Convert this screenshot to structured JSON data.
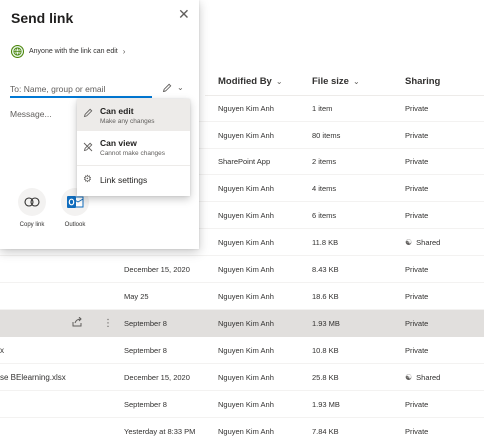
{
  "columns": {
    "modified_by": "Modified By",
    "file_size": "File size",
    "sharing": "Sharing"
  },
  "rows": [
    {
      "name": "",
      "modified": "",
      "modified_by": "Nguyen Kim Anh",
      "size": "1 item",
      "sharing": "Private"
    },
    {
      "name": "",
      "modified": "",
      "modified_by": "Nguyen Kim Anh",
      "size": "80 items",
      "sharing": "Private"
    },
    {
      "name": "",
      "modified": "",
      "modified_by": "SharePoint App",
      "size": "2 items",
      "sharing": "Private"
    },
    {
      "name": "",
      "modified": "",
      "modified_by": "Nguyen Kim Anh",
      "size": "4 items",
      "sharing": "Private"
    },
    {
      "name": "",
      "modified": "",
      "modified_by": "Nguyen Kim Anh",
      "size": "6 items",
      "sharing": "Private"
    },
    {
      "name": "",
      "modified": "",
      "modified_by": "Nguyen Kim Anh",
      "size": "11.8 KB",
      "sharing": "Shared"
    },
    {
      "name": "",
      "modified": "December 15, 2020",
      "modified_by": "Nguyen Kim Anh",
      "size": "8.43 KB",
      "sharing": "Private"
    },
    {
      "name": "",
      "modified": "May 25",
      "modified_by": "Nguyen Kim Anh",
      "size": "18.6 KB",
      "sharing": "Private"
    },
    {
      "name": "",
      "modified": "September 8",
      "modified_by": "Nguyen Kim Anh",
      "size": "1.93 MB",
      "sharing": "Private"
    },
    {
      "name": "x",
      "modified": "September 8",
      "modified_by": "Nguyen Kim Anh",
      "size": "10.8 KB",
      "sharing": "Private"
    },
    {
      "name": "se BElearning.xlsx",
      "modified": "December 15, 2020",
      "modified_by": "Nguyen Kim Anh",
      "size": "25.8 KB",
      "sharing": "Shared"
    },
    {
      "name": "",
      "modified": "September 8",
      "modified_by": "Nguyen Kim Anh",
      "size": "1.93 MB",
      "sharing": "Private"
    },
    {
      "name": "",
      "modified": "Yesterday at 8:33 PM",
      "modified_by": "Nguyen Kim Anh",
      "size": "7.84 KB",
      "sharing": "Private"
    }
  ],
  "panel": {
    "title": "Send link",
    "scope_label": "Anyone with the link can edit",
    "to_placeholder": "To: Name, group or email",
    "message_placeholder": "Message...",
    "copy_link_label": "Copy link",
    "outlook_label": "Outlook"
  },
  "menu": {
    "can_edit_title": "Can edit",
    "can_edit_sub": "Make any changes",
    "can_view_title": "Can view",
    "can_view_sub": "Cannot make changes",
    "link_settings": "Link settings"
  },
  "icons": {
    "close": "close-icon",
    "globe": "globe-icon",
    "pencil": "pencil-icon",
    "no_edit": "no-edit-icon",
    "gear": "gear-icon",
    "link": "link-icon",
    "outlook": "outlook-icon",
    "share": "share-icon",
    "more": "more-icon",
    "people": "shared-people-icon"
  },
  "colors": {
    "accent": "#0078d4",
    "selected_row": "#e1dfdd",
    "menu_active": "#edebe9",
    "outlook_blue": "#0f6cbd",
    "globe_green": "#498205"
  }
}
